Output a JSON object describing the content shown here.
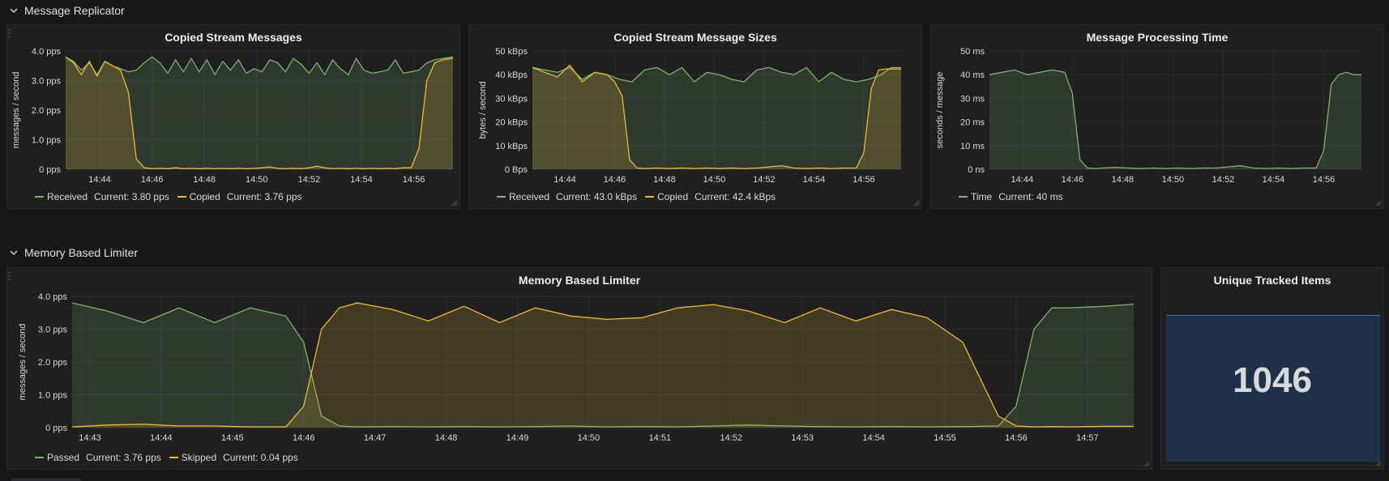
{
  "rows": {
    "replicator_title": "Message Replicator",
    "limiter_title": "Memory Based Limiter"
  },
  "colors": {
    "green": "#7eb26d",
    "yellow": "#eab839",
    "grid": "#2c2d30",
    "stat_bg": "#1f3149",
    "stat_border": "#2f76c6"
  },
  "icons": {
    "row_toggle": "chevron-down-icon",
    "drag": "drag-handle-icon",
    "resize": "resize-handle-icon"
  },
  "panels": {
    "copied_messages": {
      "title": "Copied Stream Messages",
      "legend": [
        {
          "name": "Received",
          "current": "Current: 3.80 pps"
        },
        {
          "name": "Copied",
          "current": "Current: 3.76 pps"
        }
      ]
    },
    "copied_sizes": {
      "title": "Copied Stream Message Sizes",
      "legend": [
        {
          "name": "Received",
          "current": "Current: 43.0 kBps"
        },
        {
          "name": "Copied",
          "current": "Current: 42.4 kBps"
        }
      ]
    },
    "processing_time": {
      "title": "Message Processing Time",
      "legend": [
        {
          "name": "Time",
          "current": "Current: 40 ms"
        }
      ]
    },
    "limiter": {
      "title": "Memory Based Limiter",
      "legend": [
        {
          "name": "Passed",
          "current": "Current: 3.76 pps"
        },
        {
          "name": "Skipped",
          "current": "Current: 0.04 pps"
        }
      ]
    },
    "unique_items": {
      "title": "Unique Tracked Items",
      "value": "1046"
    }
  },
  "chart_data": [
    {
      "type": "area",
      "title": "Copied Stream Messages",
      "ylabel": "messages / second",
      "yticks": [
        "0 pps",
        "1.0 pps",
        "2.0 pps",
        "3.0 pps",
        "4.0 pps"
      ],
      "ylim": [
        0,
        4
      ],
      "xticks": [
        "14:44",
        "14:46",
        "14:48",
        "14:50",
        "14:52",
        "14:54",
        "14:56"
      ],
      "xtick_values": [
        1,
        3,
        5,
        7,
        9,
        11,
        13
      ],
      "xlim": [
        -0.3,
        14.5
      ],
      "grid": true,
      "legend_position": "bottom-left",
      "series": [
        {
          "name": "Received",
          "color": "#7eb26d",
          "x": [
            -0.3,
            0,
            0.3,
            0.6,
            0.9,
            1.2,
            1.5,
            1.8,
            2.1,
            2.4,
            2.7,
            3.0,
            3.3,
            3.6,
            3.9,
            4.2,
            4.5,
            4.8,
            5.1,
            5.4,
            5.7,
            6.0,
            6.3,
            6.6,
            6.9,
            7.2,
            7.5,
            7.8,
            8.1,
            8.4,
            8.7,
            9.0,
            9.3,
            9.6,
            9.9,
            10.2,
            10.5,
            10.8,
            11.1,
            11.4,
            11.7,
            12.0,
            12.3,
            12.6,
            12.9,
            13.2,
            13.5,
            13.8,
            14.1,
            14.5
          ],
          "y": [
            3.8,
            3.65,
            3.35,
            3.6,
            3.2,
            3.65,
            3.5,
            3.4,
            3.3,
            3.35,
            3.6,
            3.8,
            3.6,
            3.25,
            3.7,
            3.3,
            3.75,
            3.3,
            3.7,
            3.2,
            3.65,
            3.35,
            3.7,
            3.25,
            3.4,
            3.3,
            3.7,
            3.6,
            3.3,
            3.75,
            3.55,
            3.25,
            3.6,
            3.2,
            3.7,
            3.4,
            3.2,
            3.75,
            3.35,
            3.25,
            3.3,
            3.35,
            3.7,
            3.25,
            3.3,
            3.35,
            3.6,
            3.7,
            3.75,
            3.8
          ]
        },
        {
          "name": "Copied",
          "color": "#eab839",
          "x": [
            -0.3,
            0,
            0.3,
            0.6,
            0.9,
            1.2,
            1.5,
            1.8,
            2.1,
            2.4,
            2.7,
            3.0,
            3.3,
            3.6,
            3.9,
            4.2,
            4.5,
            4.8,
            5.1,
            5.4,
            5.7,
            6.0,
            6.3,
            6.6,
            6.9,
            7.2,
            7.5,
            7.8,
            8.1,
            8.4,
            8.7,
            9.0,
            9.3,
            9.6,
            9.9,
            10.2,
            10.5,
            10.8,
            11.1,
            11.4,
            11.7,
            12.0,
            12.3,
            12.6,
            12.9,
            13.2,
            13.5,
            13.8,
            14.1,
            14.5
          ],
          "y": [
            3.8,
            3.6,
            3.2,
            3.65,
            3.15,
            3.65,
            3.5,
            3.35,
            2.6,
            0.35,
            0.05,
            0.02,
            0.03,
            0.02,
            0.05,
            0.02,
            0.03,
            0.02,
            0.03,
            0.02,
            0.03,
            0.02,
            0.03,
            0.02,
            0.03,
            0.05,
            0.08,
            0.03,
            0.02,
            0.03,
            0.02,
            0.05,
            0.1,
            0.05,
            0.02,
            0.03,
            0.02,
            0.03,
            0.02,
            0.03,
            0.02,
            0.03,
            0.02,
            0.05,
            0.05,
            0.7,
            3.0,
            3.6,
            3.7,
            3.76
          ]
        }
      ]
    },
    {
      "type": "area",
      "title": "Copied Stream Message Sizes",
      "ylabel": "bytes / second",
      "yticks": [
        "0 Bps",
        "10 kBps",
        "20 kBps",
        "30 kBps",
        "40 kBps",
        "50 kBps"
      ],
      "ylim": [
        0,
        50
      ],
      "xticks": [
        "14:44",
        "14:46",
        "14:48",
        "14:50",
        "14:52",
        "14:54",
        "14:56"
      ],
      "xtick_values": [
        1,
        3,
        5,
        7,
        9,
        11,
        13
      ],
      "xlim": [
        -0.3,
        14.5
      ],
      "grid": true,
      "legend_position": "bottom-left",
      "series": [
        {
          "name": "Received",
          "color": "#7eb26d",
          "x": [
            -0.3,
            0.2,
            0.7,
            1.2,
            1.7,
            2.2,
            2.7,
            3.2,
            3.7,
            4.2,
            4.7,
            5.2,
            5.7,
            6.2,
            6.7,
            7.2,
            7.7,
            8.2,
            8.7,
            9.2,
            9.7,
            10.2,
            10.7,
            11.2,
            11.7,
            12.2,
            12.7,
            13.2,
            13.7,
            14.1,
            14.5
          ],
          "y": [
            43,
            42,
            41,
            43,
            38,
            41,
            40,
            38,
            37,
            42,
            43,
            40,
            43,
            37,
            41,
            40,
            38,
            37,
            42,
            43,
            41,
            40,
            43,
            37,
            41,
            38,
            37,
            38,
            40,
            43,
            43
          ]
        },
        {
          "name": "Copied",
          "color": "#eab839",
          "x": [
            -0.3,
            0.2,
            0.7,
            1.2,
            1.7,
            2.2,
            2.7,
            3.0,
            3.3,
            3.6,
            3.9,
            4.2,
            4.7,
            5.2,
            5.7,
            6.2,
            6.7,
            7.2,
            7.7,
            8.2,
            8.7,
            9.2,
            9.7,
            10.2,
            10.7,
            11.2,
            11.7,
            12.2,
            12.7,
            13.0,
            13.3,
            13.6,
            13.9,
            14.2,
            14.5
          ],
          "y": [
            43,
            41,
            39,
            44,
            37,
            41,
            40,
            37,
            31,
            4,
            0.5,
            0.3,
            0.5,
            0.3,
            0.5,
            0.3,
            0.5,
            0.3,
            0.5,
            0.3,
            0.5,
            1.0,
            1.5,
            0.5,
            0.3,
            0.5,
            0.3,
            0.5,
            0.5,
            7,
            34,
            42,
            42.4,
            42.4,
            42.4
          ]
        }
      ]
    },
    {
      "type": "area",
      "title": "Message Processing Time",
      "ylabel": "seconds / message",
      "yticks": [
        "0 ns",
        "10 ms",
        "20 ms",
        "30 ms",
        "40 ms",
        "50 ms"
      ],
      "ylim": [
        0,
        50
      ],
      "xticks": [
        "14:44",
        "14:46",
        "14:48",
        "14:50",
        "14:52",
        "14:54",
        "14:56"
      ],
      "xtick_values": [
        1,
        3,
        5,
        7,
        9,
        11,
        13
      ],
      "xlim": [
        -0.3,
        14.5
      ],
      "grid": true,
      "legend_position": "bottom-left",
      "series": [
        {
          "name": "Time",
          "color": "#7eb26d",
          "x": [
            -0.3,
            0.2,
            0.7,
            1.2,
            1.7,
            2.2,
            2.7,
            3.0,
            3.3,
            3.6,
            3.9,
            4.2,
            4.7,
            5.2,
            5.7,
            6.2,
            6.7,
            7.2,
            7.7,
            8.2,
            8.7,
            9.2,
            9.7,
            10.2,
            10.7,
            11.2,
            11.7,
            12.2,
            12.7,
            13.0,
            13.3,
            13.6,
            13.9,
            14.2,
            14.5
          ],
          "y": [
            40,
            41,
            42,
            40,
            41,
            42,
            41,
            32,
            4,
            0.5,
            0.3,
            0.5,
            0.8,
            0.5,
            0.3,
            0.5,
            0.3,
            0.5,
            0.3,
            0.5,
            0.5,
            1.0,
            1.5,
            0.5,
            0.3,
            0.5,
            0.3,
            0.5,
            0.5,
            8,
            36,
            40,
            41,
            40,
            40
          ]
        }
      ]
    },
    {
      "type": "area",
      "title": "Memory Based Limiter",
      "ylabel": "messages / second",
      "yticks": [
        "0 pps",
        "1.0 pps",
        "2.0 pps",
        "3.0 pps",
        "4.0 pps"
      ],
      "ylim": [
        0,
        4
      ],
      "xticks": [
        "14:43",
        "14:44",
        "14:45",
        "14:46",
        "14:47",
        "14:48",
        "14:49",
        "14:50",
        "14:51",
        "14:52",
        "14:53",
        "14:54",
        "14:55",
        "14:56",
        "14:57"
      ],
      "xtick_values": [
        0,
        1,
        2,
        3,
        4,
        5,
        6,
        7,
        8,
        9,
        10,
        11,
        12,
        13,
        14
      ],
      "xlim": [
        -0.25,
        14.65
      ],
      "grid": true,
      "legend_position": "bottom-left",
      "series": [
        {
          "name": "Passed",
          "color": "#7eb26d",
          "x": [
            -0.25,
            0.25,
            0.75,
            1.25,
            1.75,
            2.25,
            2.75,
            3.0,
            3.25,
            3.5,
            3.75,
            4.25,
            4.75,
            5.25,
            5.75,
            6.25,
            6.75,
            7.25,
            7.75,
            8.25,
            8.75,
            9.25,
            9.75,
            10.25,
            10.75,
            11.25,
            11.75,
            12.25,
            12.75,
            13.0,
            13.25,
            13.5,
            13.75,
            14.25,
            14.65
          ],
          "y": [
            3.8,
            3.55,
            3.2,
            3.65,
            3.2,
            3.65,
            3.4,
            2.6,
            0.35,
            0.05,
            0.02,
            0.03,
            0.02,
            0.03,
            0.02,
            0.03,
            0.05,
            0.02,
            0.03,
            0.02,
            0.05,
            0.08,
            0.05,
            0.03,
            0.02,
            0.03,
            0.02,
            0.03,
            0.05,
            0.65,
            3.0,
            3.65,
            3.65,
            3.7,
            3.76
          ]
        },
        {
          "name": "Skipped",
          "color": "#eab839",
          "x": [
            -0.25,
            0.25,
            0.75,
            1.25,
            1.75,
            2.25,
            2.75,
            3.0,
            3.25,
            3.5,
            3.75,
            4.25,
            4.75,
            5.25,
            5.75,
            6.25,
            6.75,
            7.25,
            7.75,
            8.25,
            8.75,
            9.25,
            9.75,
            10.25,
            10.75,
            11.25,
            11.75,
            12.25,
            12.75,
            13.0,
            13.25,
            13.5,
            13.75,
            14.25,
            14.65
          ],
          "y": [
            0.02,
            0.08,
            0.1,
            0.05,
            0.05,
            0.02,
            0.02,
            0.65,
            3.0,
            3.65,
            3.8,
            3.6,
            3.25,
            3.7,
            3.2,
            3.65,
            3.4,
            3.3,
            3.35,
            3.65,
            3.75,
            3.55,
            3.2,
            3.65,
            3.25,
            3.6,
            3.35,
            2.6,
            0.35,
            0.05,
            0.02,
            0.03,
            0.02,
            0.04,
            0.04
          ]
        }
      ]
    }
  ]
}
